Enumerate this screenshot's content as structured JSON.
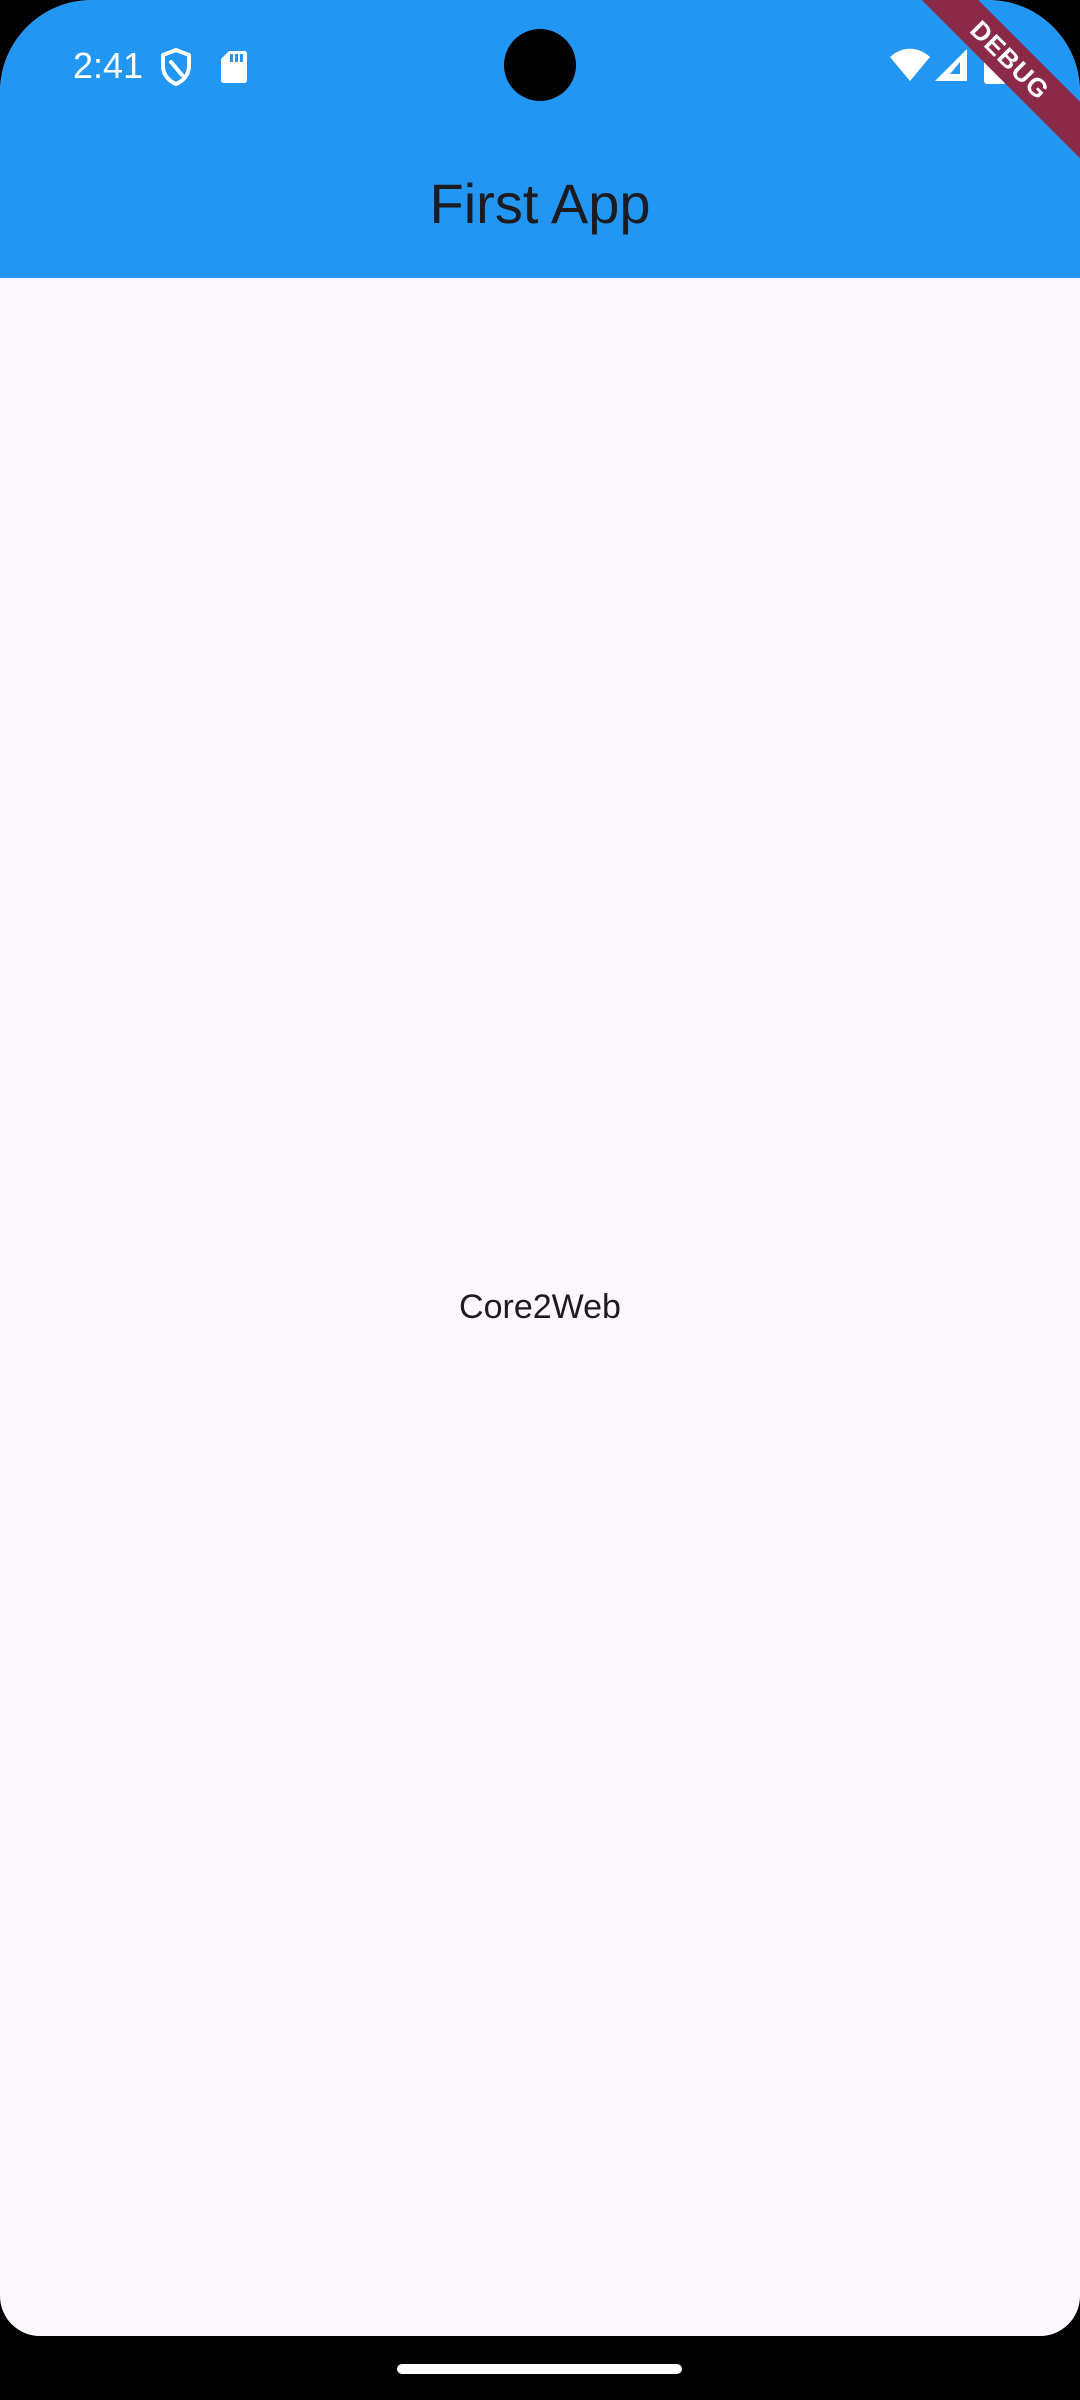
{
  "status_bar": {
    "time": "2:41",
    "left_icons": [
      "shield-icon",
      "sd-card-icon"
    ],
    "right_icons": [
      "wifi-icon",
      "cellular-signal-icon",
      "battery-icon"
    ]
  },
  "app_bar": {
    "title": "First App",
    "background_color": "#2196F3"
  },
  "debug_banner": {
    "label": "DEBUG",
    "color": "#8B2A48"
  },
  "body": {
    "center_text": "Core2Web",
    "background_color": "#FCF6FD"
  },
  "navigation": {
    "gesture_handle": "home-gesture-handle"
  }
}
